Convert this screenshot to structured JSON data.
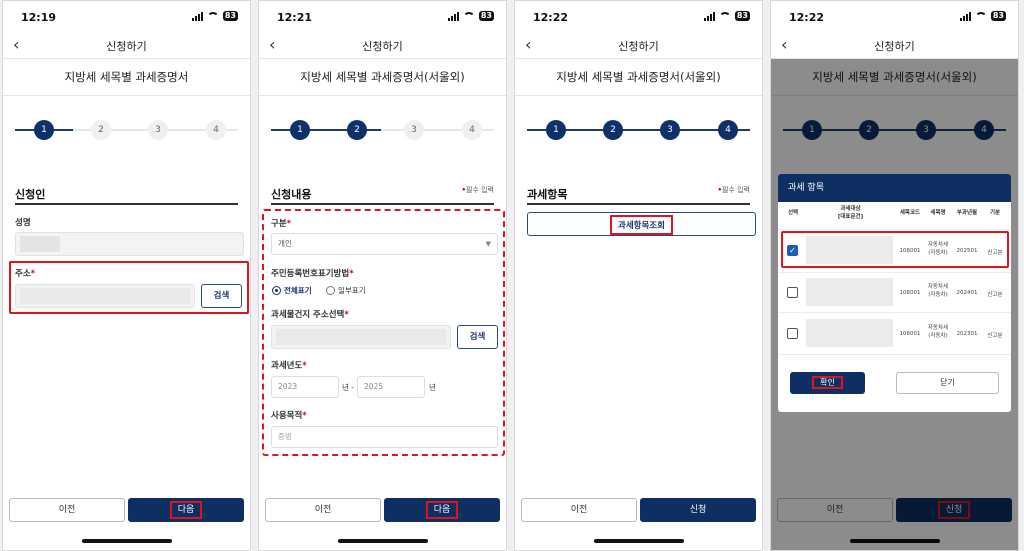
{
  "screens": [
    {
      "time": "12:19",
      "battery": "83",
      "nav_title": "신청하기",
      "doc_title": "지방세 세목별 과세증명서",
      "steps": [
        "1",
        "2",
        "3",
        "4"
      ],
      "section_title": "신청인",
      "name_label": "성명",
      "address_label": "주소",
      "search_label": "검색",
      "prev_label": "이전",
      "next_label": "다음"
    },
    {
      "time": "12:21",
      "battery": "83",
      "nav_title": "신청하기",
      "doc_title": "지방세 세목별 과세증명서(서울외)",
      "steps": [
        "1",
        "2",
        "3",
        "4"
      ],
      "section_title": "신청내용",
      "required_note": "필수 입력",
      "type_label": "구분",
      "type_value": "개인",
      "rrn_label": "주민등록번호표기방법",
      "radio_full": "전체표기",
      "radio_partial": "일부표기",
      "address_label": "과세물건지 주소선택",
      "search_label": "검색",
      "year_label": "과세년도",
      "year_from": "2023",
      "year_sep": "년 -",
      "year_to": "2025",
      "year_unit": "년",
      "purpose_label": "사용목적",
      "purpose_placeholder": "증빙",
      "prev_label": "이전",
      "next_label": "다음"
    },
    {
      "time": "12:22",
      "battery": "83",
      "nav_title": "신청하기",
      "doc_title": "지방세 세목별 과세증명서(서울외)",
      "steps": [
        "1",
        "2",
        "3",
        "4"
      ],
      "section_title": "과세항목",
      "required_note": "필수 입력",
      "lookup_label": "과세항목조회",
      "prev_label": "이전",
      "apply_label": "신청"
    },
    {
      "time": "12:22",
      "battery": "83",
      "nav_title": "신청하기",
      "doc_title": "지방세 세목별 과세증명서(서울외)",
      "steps": [
        "1",
        "2",
        "3",
        "4"
      ],
      "prev_label": "이전",
      "apply_label": "신청",
      "modal": {
        "title": "과세 항목",
        "headers": [
          "선택",
          "과세대상\n[대표문건]",
          "세목코드",
          "세목명",
          "부과년월",
          "기분"
        ],
        "rows": [
          {
            "checked": true,
            "code": "106001",
            "tax_name": "자동차세(자동차)",
            "period": "202501",
            "term": "신고분"
          },
          {
            "checked": false,
            "code": "106001",
            "tax_name": "자동차세(자동차)",
            "period": "202401",
            "term": "신고분"
          },
          {
            "checked": false,
            "code": "106001",
            "tax_name": "자동차세(자동차)",
            "period": "202301",
            "term": "신고분"
          }
        ],
        "ok_label": "확인",
        "close_label": "닫기"
      }
    }
  ]
}
